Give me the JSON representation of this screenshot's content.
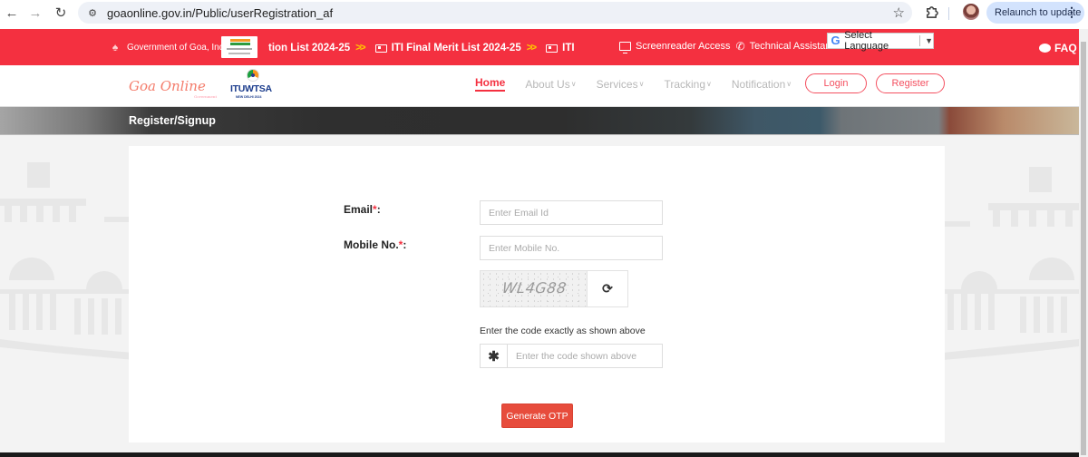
{
  "browser": {
    "url": "goaonline.gov.in/Public/userRegistration_af",
    "relaunch_label": "Relaunch to update",
    "icons": {
      "back": "arrow-left-icon",
      "forward": "arrow-right-icon",
      "reload": "reload-icon",
      "site_info": "tune-icon",
      "bookmark": "star-icon",
      "extensions": "puzzle-icon",
      "menu": "kebab-icon"
    }
  },
  "topbar": {
    "government_label": "Government of Goa, India",
    "ticker": [
      {
        "label": "tion List 2024-25",
        "arrow": ">>"
      },
      {
        "label": "ITI Final Merit List 2024-25",
        "arrow": ">>"
      },
      {
        "label": "ITI F",
        "arrow": ""
      }
    ],
    "screenreader_label": "Screenreader Access",
    "technical_label": "Technical Assistance",
    "language_label": "Select Language",
    "language_caret": "▼",
    "faq_label": "FAQ"
  },
  "header": {
    "logo_text": "Goa Online",
    "logo_sub": "Government",
    "itu_logo_text": "ITUWTSA",
    "itu_logo_sub": "NEW DELHI 2024",
    "menu": [
      {
        "label": "Home",
        "active": true,
        "dropdown": false
      },
      {
        "label": "About Us",
        "active": false,
        "dropdown": true
      },
      {
        "label": "Services",
        "active": false,
        "dropdown": true
      },
      {
        "label": "Tracking",
        "active": false,
        "dropdown": true
      },
      {
        "label": "Notification",
        "active": false,
        "dropdown": true
      }
    ],
    "login_label": "Login",
    "register_label": "Register"
  },
  "banner": {
    "title": "Register/Signup"
  },
  "form": {
    "email_label": "Email",
    "mobile_label": "Mobile No.",
    "required_mark": "*",
    "colon": ":",
    "email_placeholder": "Enter Email Id",
    "email_value": "",
    "mobile_placeholder": "Enter Mobile No.",
    "mobile_value": "",
    "captcha_text": "WL4G88",
    "captcha_hint": "Enter the code exactly as shown above",
    "code_placeholder": "Enter the code shown above",
    "code_value": "",
    "code_prefix": "✱",
    "submit_label": "Generate OTP"
  },
  "colors": {
    "brand_red": "#f43040",
    "button_red": "#e74c3c",
    "ticker_arrow": "#ffc400"
  }
}
